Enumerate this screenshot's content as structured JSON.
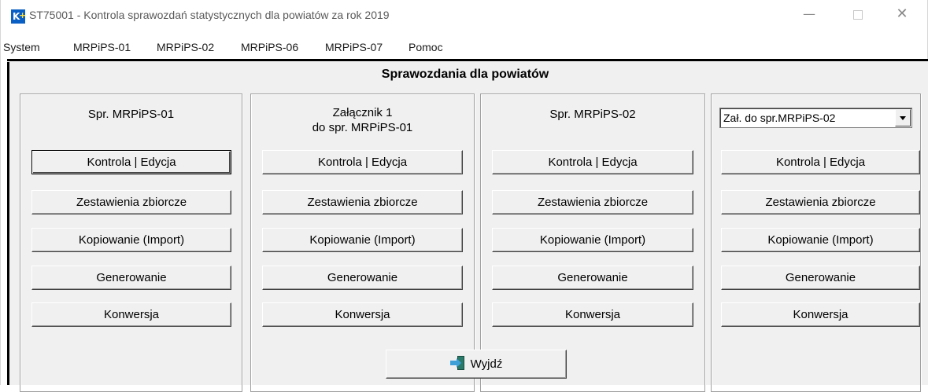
{
  "window": {
    "app_icon": "K+",
    "title": "ST75001 - Kontrola sprawozdań statystycznych dla powiatów za rok 2019",
    "minimize_glyph": "—",
    "close_glyph": "✕"
  },
  "menu": {
    "items": [
      "System",
      "MRPiPS-01",
      "MRPiPS-02",
      "MRPiPS-06",
      "MRPiPS-07",
      "Pomoc"
    ]
  },
  "main": {
    "title": "Sprawozdania dla powiatów",
    "groups": [
      {
        "heading_line1": "Spr. MRPiPS-01",
        "heading_line2": "",
        "buttons": [
          "Kontrola | Edycja",
          "Zestawienia zbiorcze",
          "Kopiowanie (Import)",
          "Generowanie",
          "Konwersja"
        ]
      },
      {
        "heading_line1": "Załącznik 1",
        "heading_line2": "do spr. MRPiPS-01",
        "buttons": [
          "Kontrola | Edycja",
          "Zestawienia zbiorcze",
          "Kopiowanie (Import)",
          "Generowanie",
          "Konwersja"
        ]
      },
      {
        "heading_line1": "Spr. MRPiPS-02",
        "heading_line2": "",
        "buttons": [
          "Kontrola | Edycja",
          "Zestawienia zbiorcze",
          "Kopiowanie (Import)",
          "Generowanie",
          "Konwersja"
        ]
      },
      {
        "select_value": "Zał. do spr.MRPiPS-02",
        "buttons": [
          "Kontrola | Edycja",
          "Zestawienia zbiorcze",
          "Kopiowanie (Import)",
          "Generowanie",
          "Konwersja"
        ]
      }
    ],
    "exit_label": "Wyjdź"
  }
}
